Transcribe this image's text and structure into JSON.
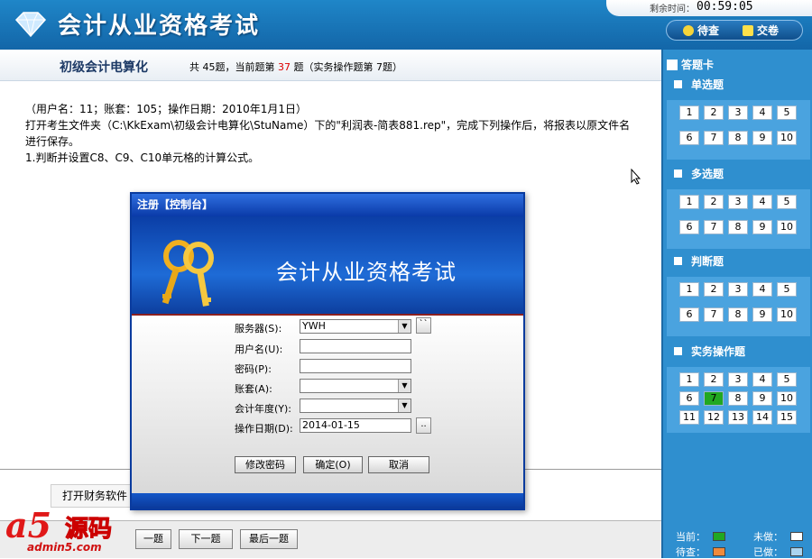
{
  "app": {
    "title": "会计从业资格考试",
    "timer_label": "剩余时间：",
    "timer_value": "00:59:05",
    "pending_label": "待查",
    "submit_label": "交卷"
  },
  "question_header": {
    "section": "初级会计电算化",
    "info_prefix": "共 45题，当前题第",
    "current_number": "37",
    "info_suffix": "题（实务操作题第 7题）"
  },
  "question_body": {
    "line1": "（用户名：11；账套：105；操作日期：2010年1月1日）",
    "line2": "打开考生文件夹（C:\\KkExam\\初级会计电算化\\StuName）下的\"利润表-简表881.rep\"，完成下列操作后，将报表以原文件名",
    "line3": "进行保存。",
    "line4": "1.判断并设置C8、C9、C10单元格的计算公式。"
  },
  "sidebar": {
    "header": "答题卡",
    "sections": [
      {
        "title": "单选题",
        "rows": [
          [
            "1",
            "2",
            "3",
            "4",
            "5"
          ],
          [
            "6",
            "7",
            "8",
            "9",
            "10"
          ]
        ]
      },
      {
        "title": "多选题",
        "rows": [
          [
            "1",
            "2",
            "3",
            "4",
            "5"
          ],
          [
            "6",
            "7",
            "8",
            "9",
            "10"
          ]
        ]
      },
      {
        "title": "判断题",
        "rows": [
          [
            "1",
            "2",
            "3",
            "4",
            "5"
          ],
          [
            "6",
            "7",
            "8",
            "9",
            "10"
          ]
        ]
      },
      {
        "title": "实务操作题",
        "rows": [
          [
            "1",
            "2",
            "3",
            "4",
            "5"
          ],
          [
            "6",
            "7",
            "8",
            "9",
            "10"
          ],
          [
            "11",
            "12",
            "13",
            "14",
            "15"
          ]
        ]
      }
    ],
    "legend": {
      "current": "当前：",
      "undone": "未做：",
      "pending": "待查：",
      "done": "已做："
    },
    "colors": {
      "current": "#21a821",
      "undone": "#ffffff",
      "pending": "#f08a3c",
      "done": "#aad4f0"
    }
  },
  "bottom": {
    "open_software": "打开财务软件",
    "prev": "一题",
    "next": "下一题",
    "last": "最后一题"
  },
  "watermark": {
    "brand": "a5",
    "word": "源码",
    "url": "admin5.com"
  },
  "dialog": {
    "title": "注册【控制台】",
    "banner_title": "会计从业资格考试",
    "server_label": "服务器(S):",
    "server_value": "YWH",
    "user_label": "用户名(U):",
    "user_value": "",
    "password_label": "密码(P):",
    "password_value": "",
    "account_label": "账套(A):",
    "account_value": "",
    "year_label": "会计年度(Y):",
    "year_value": "",
    "date_label": "操作日期(D):",
    "date_value": "2014-01-15",
    "server_btn": "``",
    "date_btn": "..",
    "change_pwd": "修改密码",
    "ok": "确定(O)",
    "cancel": "取消"
  }
}
